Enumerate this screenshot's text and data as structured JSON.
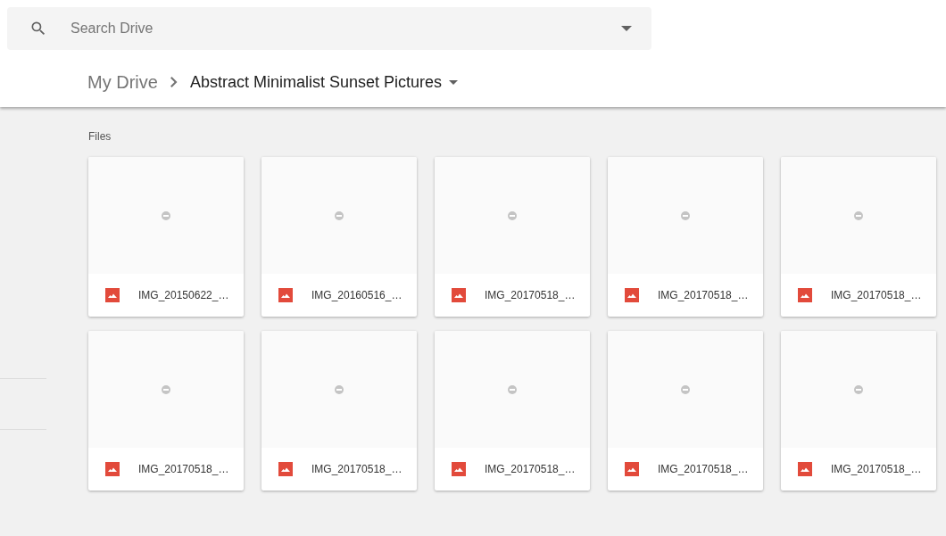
{
  "search": {
    "placeholder": "Search Drive"
  },
  "breadcrumb": [
    {
      "label": "My Drive",
      "current": false
    },
    {
      "label": "Abstract Minimalist Sunset Pictures",
      "current": true
    }
  ],
  "section_title": "Files",
  "files": [
    {
      "name": "IMG_20150622_…"
    },
    {
      "name": "IMG_20160516_…"
    },
    {
      "name": "IMG_20170518_…"
    },
    {
      "name": "IMG_20170518_…"
    },
    {
      "name": "IMG_20170518_…"
    },
    {
      "name": "IMG_20170518_…"
    },
    {
      "name": "IMG_20170518_…"
    },
    {
      "name": "IMG_20170518_…"
    },
    {
      "name": "IMG_20170518_…"
    },
    {
      "name": "IMG_20170518_…"
    }
  ]
}
